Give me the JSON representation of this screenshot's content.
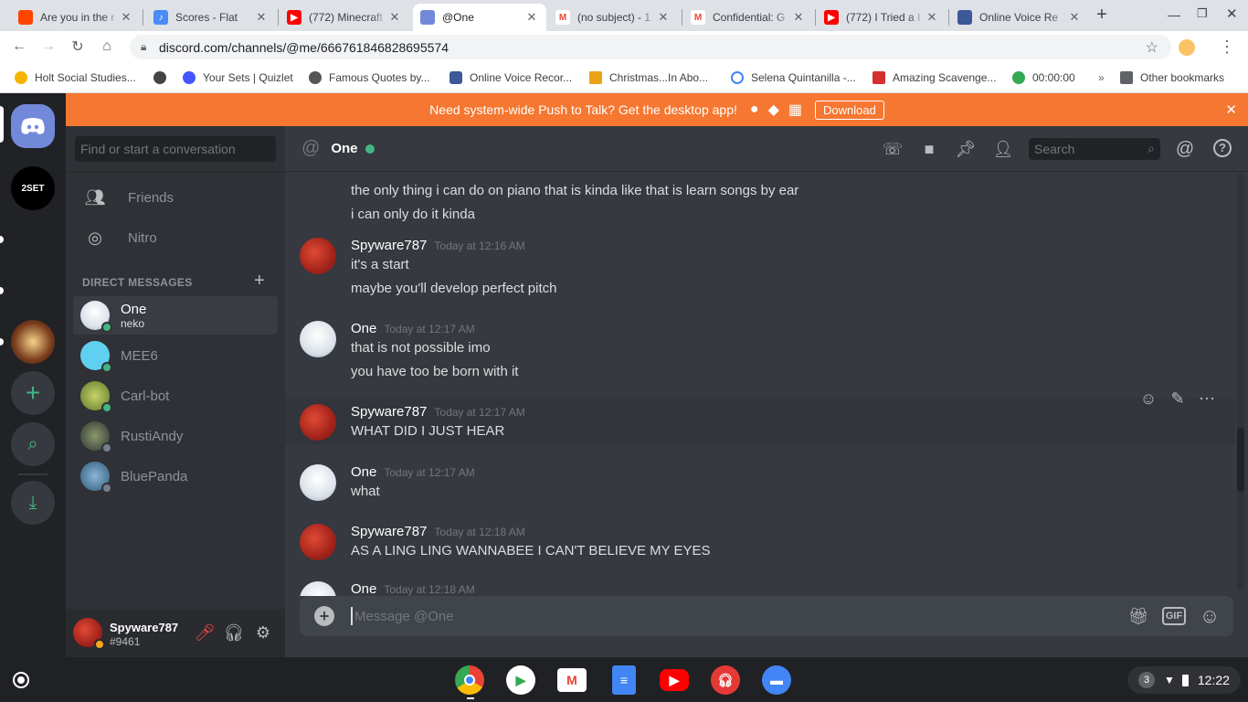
{
  "tabs": [
    {
      "title": "Are you in the r",
      "color": "#ff4500",
      "icon": "reddit-icon"
    },
    {
      "title": "Scores - Flat",
      "color": "#4a8bf6",
      "icon": "flat-icon"
    },
    {
      "title": "(772) Minecraft",
      "color": "#ff0000",
      "icon": "youtube-icon"
    },
    {
      "title": "@One",
      "color": "#7289da",
      "icon": "discord-icon"
    },
    {
      "title": "(no subject) - 1",
      "color": "#ea4335",
      "icon": "gmail-icon"
    },
    {
      "title": "Confidential: G",
      "color": "#ea4335",
      "icon": "gmail-icon"
    },
    {
      "title": "(772) I Tried a I",
      "color": "#ff0000",
      "icon": "youtube-icon"
    },
    {
      "title": "Online Voice Re",
      "color": "#3b5998",
      "icon": "voice-recorder-icon"
    }
  ],
  "url": "discord.com/channels/@me/666761846828695574",
  "bookmarks": [
    {
      "label": "Holt Social Studies...",
      "color": "#f4b400"
    },
    {
      "label": "",
      "color": "#444"
    },
    {
      "label": "Your Sets | Quizlet",
      "color": "#4255ff"
    },
    {
      "label": "Famous Quotes by...",
      "color": "#555"
    },
    {
      "label": "Online Voice Recor...",
      "color": "#3b5998"
    },
    {
      "label": "Christmas...In Abo...",
      "color": "#e8a317"
    },
    {
      "label": "Selena Quintanilla -...",
      "color": "#4285f4"
    },
    {
      "label": "Amazing Scavenge...",
      "color": "#d32f2f"
    },
    {
      "label": "00:00:00",
      "color": "#34a853"
    }
  ],
  "other_bookmarks": "Other bookmarks",
  "banner": {
    "text": "Need system-wide Push to Talk? Get the desktop app!",
    "download": "Download"
  },
  "guild_label": "2SET",
  "search_placeholder": "Find or start a conversation",
  "nav": {
    "friends": "Friends",
    "nitro": "Nitro"
  },
  "dm_header": "DIRECT MESSAGES",
  "dms": [
    {
      "name": "One",
      "sub": "neko",
      "status": "#43b581"
    },
    {
      "name": "MEE6",
      "sub": "",
      "status": "#43b581"
    },
    {
      "name": "Carl-bot",
      "sub": "",
      "status": "#43b581"
    },
    {
      "name": "RustiAndy",
      "sub": "",
      "status": "#747f8d"
    },
    {
      "name": "BluePanda",
      "sub": "",
      "status": "#747f8d"
    }
  ],
  "chat": {
    "name": "One",
    "search": "Search",
    "placeholder": "Message @One"
  },
  "messages": [
    {
      "cont": true,
      "lines": [
        "the only thing i can do on piano that is kinda like that is learn songs by ear",
        "i can only do it kinda"
      ]
    },
    {
      "user": "Spyware787",
      "time": "Today at 12:16 AM",
      "lines": [
        "it's a start",
        "maybe you'll develop perfect pitch"
      ]
    },
    {
      "user": "One",
      "time": "Today at 12:17 AM",
      "lines": [
        "that is not possible imo",
        "you have too be born with it"
      ]
    },
    {
      "user": "Spyware787",
      "time": "Today at 12:17 AM",
      "lines": [
        "WHAT DID I JUST HEAR"
      ]
    },
    {
      "user": "One",
      "time": "Today at 12:17 AM",
      "lines": [
        "what"
      ]
    },
    {
      "user": "Spyware787",
      "time": "Today at 12:18 AM",
      "lines": [
        "AS A LING LING WANNABEE I CAN'T BELIEVE MY EYES"
      ]
    },
    {
      "user": "One",
      "time": "Today at 12:18 AM",
      "lines": []
    }
  ],
  "me": {
    "name": "Spyware787",
    "tag": "#9461"
  },
  "gif": "GIF",
  "shelf": {
    "badge": "3",
    "time": "12:22"
  }
}
